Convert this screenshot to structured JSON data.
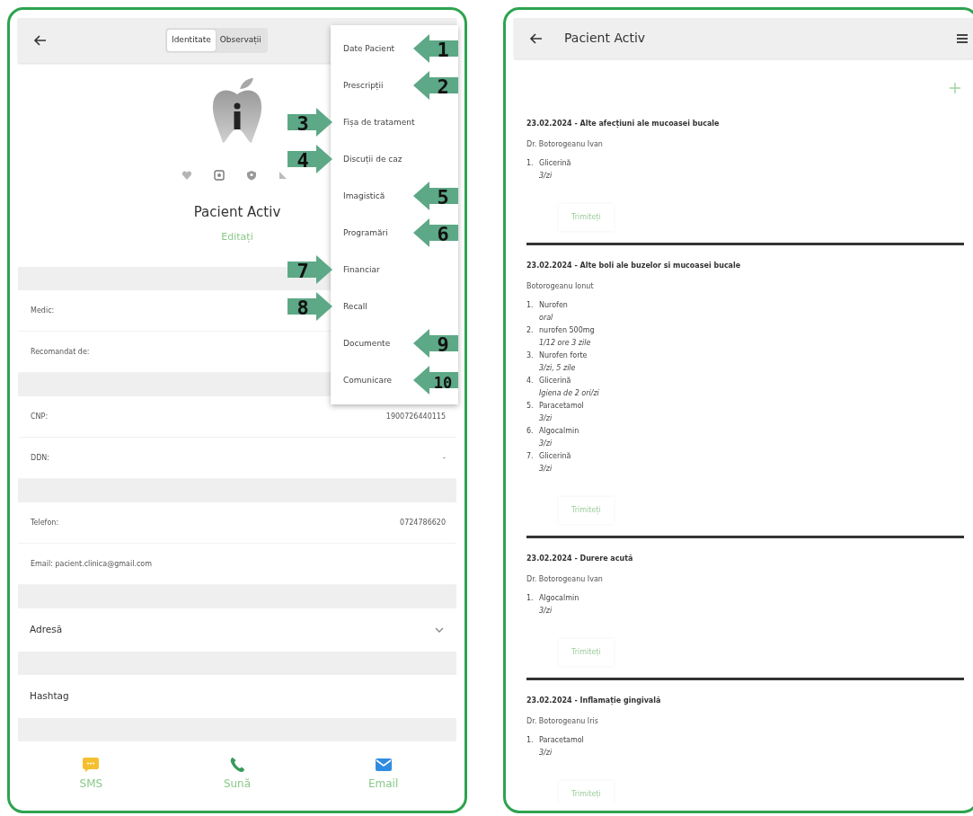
{
  "patient_screen": {
    "tabs": [
      {
        "label": "Identitate",
        "selected": true
      },
      {
        "label": "Observații",
        "selected": false
      }
    ],
    "menu": [
      {
        "label": "Date Pacient",
        "callout": {
          "number": "1",
          "kind": "left"
        }
      },
      {
        "label": "Prescripții",
        "callout": {
          "number": "2",
          "kind": "left"
        }
      },
      {
        "label": "Fișa de tratament",
        "callout": {
          "number": "3",
          "kind": "right"
        }
      },
      {
        "label": "Discuții de caz",
        "callout": {
          "number": "4",
          "kind": "right"
        }
      },
      {
        "label": "Imagistică",
        "callout": {
          "number": "5",
          "kind": "left"
        }
      },
      {
        "label": "Programări",
        "callout": {
          "number": "6",
          "kind": "left"
        }
      },
      {
        "label": "Financiar",
        "callout": {
          "number": "7",
          "kind": "right"
        }
      },
      {
        "label": "Recall",
        "callout": {
          "number": "8",
          "kind": "right"
        }
      },
      {
        "label": "Documente",
        "callout": {
          "number": "9",
          "kind": "left"
        }
      },
      {
        "label": "Comunicare",
        "callout": {
          "number": "10",
          "kind": "left"
        }
      }
    ],
    "patient_name": "Pacient Activ",
    "edit_link": "Editați",
    "rows": [
      {
        "kind": "band"
      },
      {
        "kind": "field",
        "label": "Medic:"
      },
      {
        "kind": "field",
        "label": "Recomandat de:"
      },
      {
        "kind": "band"
      },
      {
        "kind": "field",
        "label": "CNP:",
        "value": "1900726440115"
      },
      {
        "kind": "field",
        "label": "DDN:",
        "value": "-"
      },
      {
        "kind": "band"
      },
      {
        "kind": "field",
        "label": "Telefon:",
        "value": "0724786620"
      },
      {
        "kind": "field",
        "label": "Email: pacient.clinica@gmail.com"
      },
      {
        "kind": "band"
      },
      {
        "kind": "expander",
        "label": "Adresă",
        "expanded": false
      },
      {
        "kind": "band"
      },
      {
        "kind": "section",
        "label": "Hashtag"
      },
      {
        "kind": "band"
      }
    ],
    "actions": [
      {
        "label": "SMS",
        "kind": "sms"
      },
      {
        "label": "Sună",
        "kind": "call"
      },
      {
        "label": "Email",
        "kind": "email"
      }
    ]
  },
  "prescriptions_screen": {
    "title": "Pacient Activ",
    "entries": [
      {
        "title": "23.02.2024 - Alte afecțiuni ale mucoasei bucale",
        "doctor": "Dr. Botorogeanu Ivan",
        "meds": [
          {
            "number": "1.",
            "name": "Glicerină",
            "dose": "3/zi"
          }
        ],
        "send": "Trimiteți"
      },
      {
        "title": "23.02.2024 - Alte boli ale buzelor si mucoasei bucale",
        "doctor": "Botorogeanu Ionut",
        "meds": [
          {
            "number": "1.",
            "name": "Nurofen",
            "dose": "oral"
          },
          {
            "number": "2.",
            "name": "nurofen 500mg",
            "dose": "1/12 ore 3 zile"
          },
          {
            "number": "3.",
            "name": "Nurofen forte",
            "dose": "3/zi, 5 zile"
          },
          {
            "number": "4.",
            "name": "Glicerină",
            "dose": "Igiena de 2 ori/zi"
          },
          {
            "number": "5.",
            "name": "Paracetamol",
            "dose": "3/zi"
          },
          {
            "number": "6.",
            "name": "Algocalmin",
            "dose": "3/zi"
          },
          {
            "number": "7.",
            "name": "Glicerină",
            "dose": "3/zi"
          }
        ],
        "send": "Trimiteți"
      },
      {
        "title": "23.02.2024 - Durere acută",
        "doctor": "Dr. Botorogeanu Ivan",
        "meds": [
          {
            "number": "1.",
            "name": "Algocalmin",
            "dose": "3/zi"
          }
        ],
        "send": "Trimiteți"
      },
      {
        "title": "23.02.2024 - Inflamație gingivală",
        "doctor": "Dr. Botorogeanu Iris",
        "meds": [
          {
            "number": "1.",
            "name": "Paracetamol",
            "dose": "3/zi"
          }
        ],
        "send": "Trimiteți"
      }
    ]
  }
}
